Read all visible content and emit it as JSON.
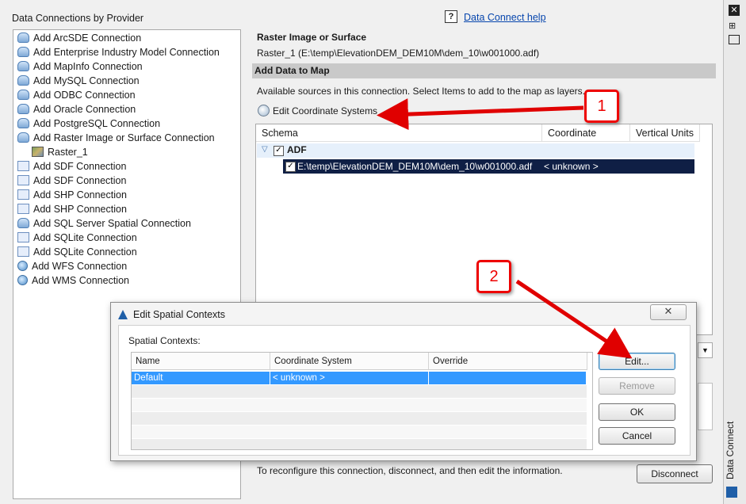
{
  "left_panel": {
    "title": "Data Connections by Provider",
    "items": [
      {
        "label": "Add ArcSDE Connection",
        "icon": "database-icon"
      },
      {
        "label": "Add Enterprise Industry Model Connection",
        "icon": "database-icon"
      },
      {
        "label": "Add MapInfo Connection",
        "icon": "database-icon"
      },
      {
        "label": "Add MySQL Connection",
        "icon": "database-icon"
      },
      {
        "label": "Add ODBC Connection",
        "icon": "database-icon"
      },
      {
        "label": "Add Oracle Connection",
        "icon": "database-icon"
      },
      {
        "label": "Add PostgreSQL Connection",
        "icon": "database-icon"
      },
      {
        "label": "Add Raster Image or Surface Connection",
        "icon": "database-icon"
      },
      {
        "label": "Raster_1",
        "icon": "raster-icon"
      },
      {
        "label": "Add SDF Connection",
        "icon": "file-icon"
      },
      {
        "label": "Add SDF Connection",
        "icon": "file-icon"
      },
      {
        "label": "Add SHP Connection",
        "icon": "file-icon"
      },
      {
        "label": "Add SHP Connection",
        "icon": "file-icon"
      },
      {
        "label": "Add SQL Server Spatial Connection",
        "icon": "database-icon"
      },
      {
        "label": "Add SQLite Connection",
        "icon": "file-icon"
      },
      {
        "label": "Add SQLite Connection",
        "icon": "file-icon"
      },
      {
        "label": "Add WFS Connection",
        "icon": "globe-icon"
      },
      {
        "label": "Add WMS Connection",
        "icon": "globe-icon"
      }
    ]
  },
  "help": {
    "icon": "?",
    "link": "Data Connect help"
  },
  "connection": {
    "title": "Raster Image or Surface",
    "path": "Raster_1 (E:\\temp\\ElevationDEM_DEM10M\\dem_10\\w001000.adf)"
  },
  "add_data": {
    "bar_title": "Add Data to Map",
    "available_text": "Available sources in this connection.  Select Items to add to the map as layers.",
    "edit_cs_label": "Edit Coordinate Systems",
    "columns": [
      "Schema",
      "Coordinate System",
      "Vertical Units"
    ],
    "group": "ADF",
    "row": {
      "schema": "E:\\temp\\ElevationDEM_DEM10M\\dem_10\\w001000.adf",
      "cs": "< unknown >"
    }
  },
  "bottom": {
    "text": "To reconfigure this connection, disconnect, and then edit the information.",
    "disconnect_label": "Disconnect"
  },
  "side_palette": {
    "title": "Data Connect"
  },
  "dialog": {
    "title": "Edit Spatial Contexts",
    "close": "✕",
    "label": "Spatial Contexts:",
    "columns": [
      "Name",
      "Coordinate System",
      "Override"
    ],
    "rows": [
      {
        "name": "Default",
        "cs": "< unknown >",
        "override": ""
      }
    ],
    "buttons": {
      "edit": "Edit...",
      "remove": "Remove",
      "ok": "OK",
      "cancel": "Cancel"
    }
  },
  "callouts": [
    "1",
    "2"
  ],
  "colors": {
    "annotation": "#e00000",
    "selected_row": "#0f1f45",
    "dialog_selected": "#3399ff"
  }
}
